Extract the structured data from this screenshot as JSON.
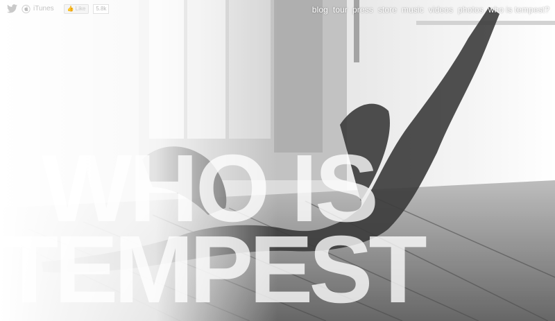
{
  "topbar": {
    "social": {
      "twitter_icon": "twitter-bird-icon",
      "apple_icon": "apple-icon",
      "itunes_label": "iTunes",
      "fb_like_label": "Like",
      "fb_like_count": "5.8k"
    },
    "nav": [
      "blog",
      "tour",
      "press",
      "store",
      "music",
      "videos",
      "photos",
      "who is tempest?"
    ]
  },
  "headline": {
    "line1": "WHO IS",
    "line2": "TEMPEST"
  },
  "colors": {
    "nav_text": "#ffffff",
    "headline_text": "#ffffff",
    "social_text": "#c4c4c4"
  }
}
